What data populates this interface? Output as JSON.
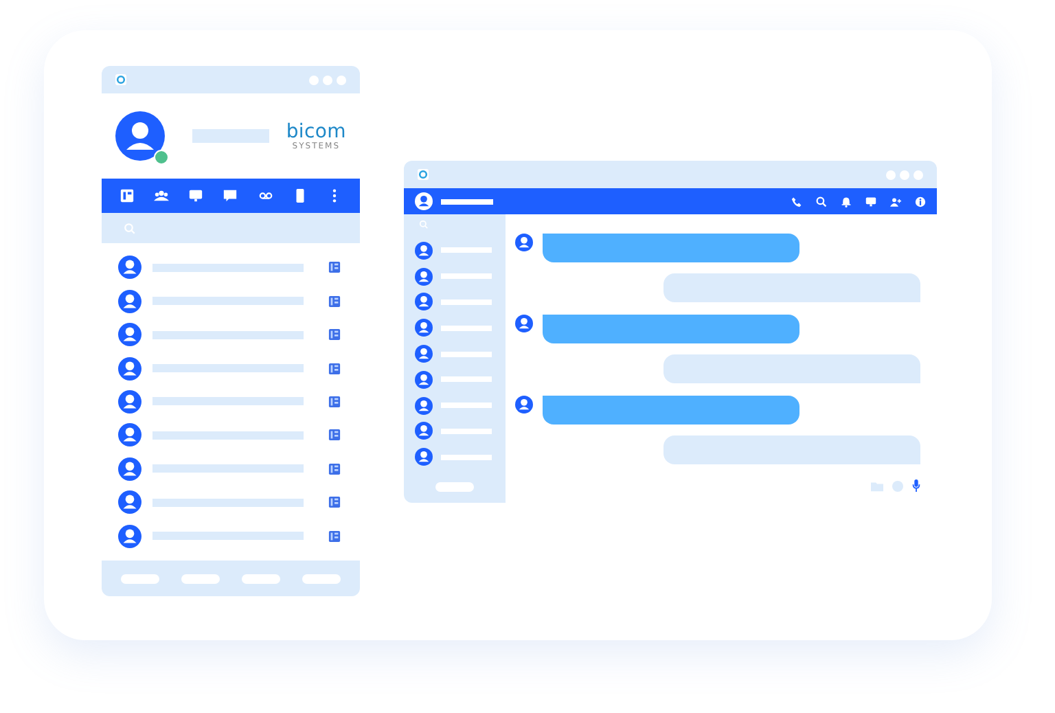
{
  "logo": {
    "name": "bicom",
    "tagline": "SYSTEMS"
  },
  "messages": [
    {
      "kind": "incoming"
    },
    {
      "kind": "outgoing"
    },
    {
      "kind": "incoming"
    },
    {
      "kind": "outgoing"
    },
    {
      "kind": "incoming"
    },
    {
      "kind": "outgoing"
    }
  ]
}
